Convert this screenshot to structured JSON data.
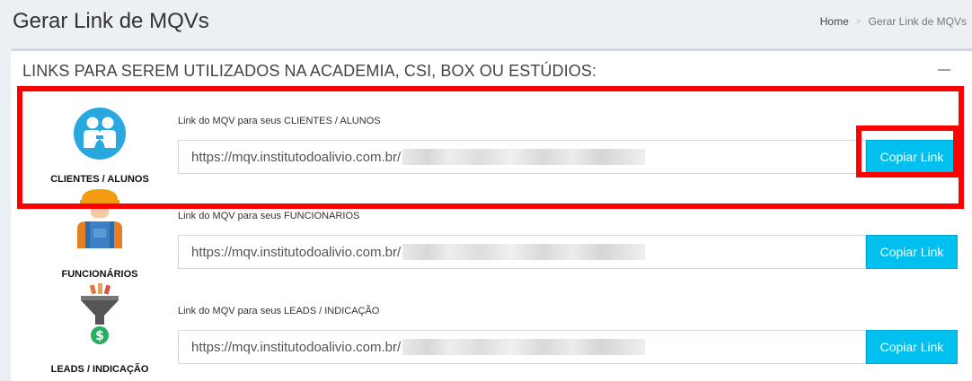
{
  "header": {
    "title": "Gerar Link de MQVs",
    "breadcrumb": {
      "home": "Home",
      "separator": ">",
      "current": "Gerar Link de MQVs"
    }
  },
  "box": {
    "title": "LINKS PARA SEREM UTILIZADOS NA ACADEMIA, CSI, BOX OU ESTÚDIOS:",
    "collapse_icon": "minus-icon"
  },
  "rows": [
    {
      "category": "CLIENTES / ALUNOS",
      "icon": "clients-icon",
      "link_label": "Link do MQV para seus CLIENTES / ALUNOS",
      "url_prefix": "https://mqv.institutodoalivio.com.br/",
      "button_label": "Copiar Link"
    },
    {
      "category": "FUNCIONÁRIOS",
      "icon": "worker-icon",
      "link_label": "Link do MQV para seus FUNCIONARIOS",
      "url_prefix": "https://mqv.institutodoalivio.com.br/",
      "button_label": "Copiar Link"
    },
    {
      "category": "LEADS / INDICAÇÃO",
      "icon": "funnel-money-icon",
      "link_label": "Link do MQV para seus LEADS / INDICAÇÃO",
      "url_prefix": "https://mqv.institutodoalivio.com.br/",
      "button_label": "Copiar Link"
    }
  ],
  "colors": {
    "button": "#00c0ef",
    "highlight": "#ff0000",
    "background": "#ecf0f5"
  }
}
